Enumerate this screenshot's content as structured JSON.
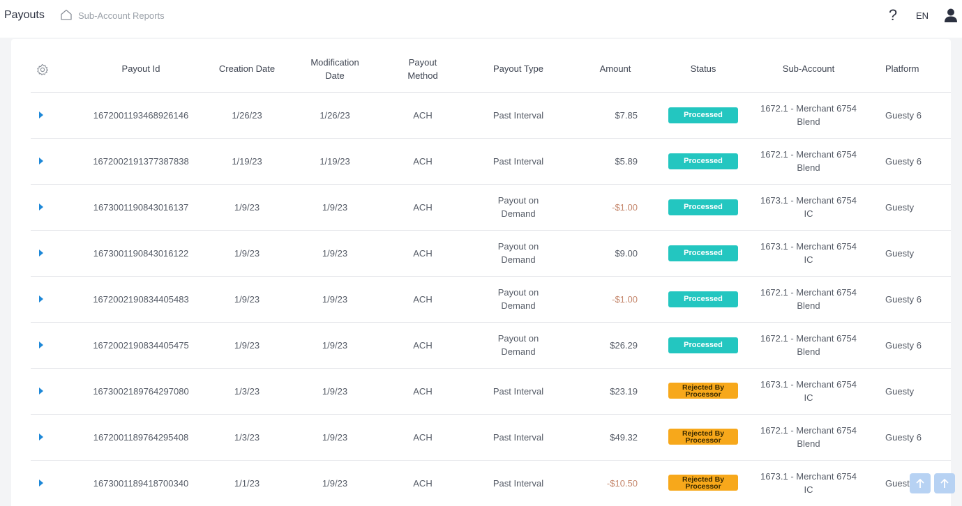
{
  "header": {
    "app_title": "Payouts",
    "breadcrumb": "Sub-Account Reports",
    "help_label": "?",
    "language": "EN"
  },
  "table": {
    "columns": {
      "payout_id": "Payout Id",
      "creation_date": "Creation Date",
      "modification_date_l1": "Modification",
      "modification_date_l2": "Date",
      "payout_method_l1": "Payout",
      "payout_method_l2": "Method",
      "payout_type": "Payout Type",
      "amount": "Amount",
      "status": "Status",
      "sub_account": "Sub-Account",
      "platform": "Platform"
    },
    "rows": [
      {
        "payout_id": "1672001193468926146",
        "creation_date": "1/26/23",
        "modification_date": "1/26/23",
        "method": "ACH",
        "type_l1": "Past Interval",
        "type_l2": "",
        "amount": "$7.85",
        "status_l1": "Processed",
        "status_l2": "",
        "sub_account_l1": "1672.1 - Merchant 6754",
        "sub_account_l2": "Blend",
        "platform": "Guesty 6"
      },
      {
        "payout_id": "1672002191377387838",
        "creation_date": "1/19/23",
        "modification_date": "1/19/23",
        "method": "ACH",
        "type_l1": "Past Interval",
        "type_l2": "",
        "amount": "$5.89",
        "status_l1": "Processed",
        "status_l2": "",
        "sub_account_l1": "1672.1 - Merchant 6754",
        "sub_account_l2": "Blend",
        "platform": "Guesty 6"
      },
      {
        "payout_id": "1673001190843016137",
        "creation_date": "1/9/23",
        "modification_date": "1/9/23",
        "method": "ACH",
        "type_l1": "Payout on",
        "type_l2": "Demand",
        "amount": "-$1.00",
        "status_l1": "Processed",
        "status_l2": "",
        "sub_account_l1": "1673.1 - Merchant 6754",
        "sub_account_l2": "IC",
        "platform": "Guesty"
      },
      {
        "payout_id": "1673001190843016122",
        "creation_date": "1/9/23",
        "modification_date": "1/9/23",
        "method": "ACH",
        "type_l1": "Payout on",
        "type_l2": "Demand",
        "amount": "$9.00",
        "status_l1": "Processed",
        "status_l2": "",
        "sub_account_l1": "1673.1 - Merchant 6754",
        "sub_account_l2": "IC",
        "platform": "Guesty"
      },
      {
        "payout_id": "1672002190834405483",
        "creation_date": "1/9/23",
        "modification_date": "1/9/23",
        "method": "ACH",
        "type_l1": "Payout on",
        "type_l2": "Demand",
        "amount": "-$1.00",
        "status_l1": "Processed",
        "status_l2": "",
        "sub_account_l1": "1672.1 - Merchant 6754",
        "sub_account_l2": "Blend",
        "platform": "Guesty 6"
      },
      {
        "payout_id": "1672002190834405475",
        "creation_date": "1/9/23",
        "modification_date": "1/9/23",
        "method": "ACH",
        "type_l1": "Payout on",
        "type_l2": "Demand",
        "amount": "$26.29",
        "status_l1": "Processed",
        "status_l2": "",
        "sub_account_l1": "1672.1 - Merchant 6754",
        "sub_account_l2": "Blend",
        "platform": "Guesty 6"
      },
      {
        "payout_id": "1673002189764297080",
        "creation_date": "1/3/23",
        "modification_date": "1/9/23",
        "method": "ACH",
        "type_l1": "Past Interval",
        "type_l2": "",
        "amount": "$23.19",
        "status_l1": "Rejected By",
        "status_l2": "Processor",
        "sub_account_l1": "1673.1 - Merchant 6754",
        "sub_account_l2": "IC",
        "platform": "Guesty"
      },
      {
        "payout_id": "1672001189764295408",
        "creation_date": "1/3/23",
        "modification_date": "1/9/23",
        "method": "ACH",
        "type_l1": "Past Interval",
        "type_l2": "",
        "amount": "$49.32",
        "status_l1": "Rejected By",
        "status_l2": "Processor",
        "sub_account_l1": "1672.1 - Merchant 6754",
        "sub_account_l2": "Blend",
        "platform": "Guesty 6"
      },
      {
        "payout_id": "1673001189418700340",
        "creation_date": "1/1/23",
        "modification_date": "1/9/23",
        "method": "ACH",
        "type_l1": "Past Interval",
        "type_l2": "",
        "amount": "-$10.50",
        "status_l1": "Rejected By",
        "status_l2": "Processor",
        "sub_account_l1": "1673.1 - Merchant 6754",
        "sub_account_l2": "IC",
        "platform": "Guesty"
      }
    ]
  },
  "colors": {
    "processed": "#23c6c0",
    "rejected": "#f7a81b",
    "expand_arrow": "#1e88d8",
    "negative_amount": "#c4856a"
  },
  "icons": {
    "settings": "gear-icon",
    "home": "home-icon",
    "help": "help-icon",
    "user": "user-icon",
    "expand": "caret-right-icon",
    "scroll_top": "arrow-up-icon"
  }
}
